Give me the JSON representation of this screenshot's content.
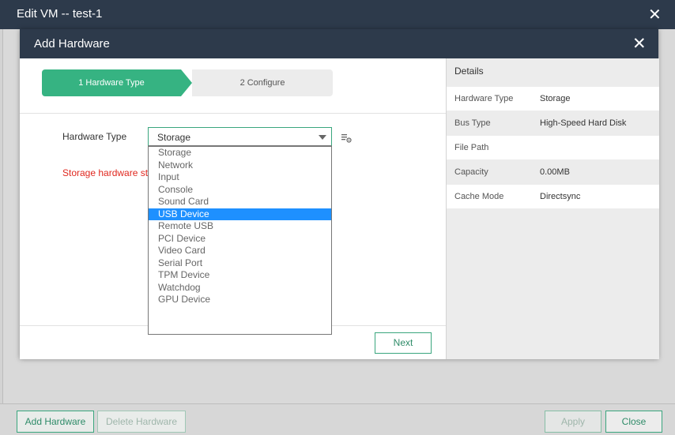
{
  "outer_window": {
    "title": "Edit VM -- test-1",
    "close_glyph": "✕",
    "buttons": {
      "add_hardware": "Add Hardware",
      "delete_hardware": "Delete Hardware",
      "apply": "Apply",
      "close": "Close"
    }
  },
  "modal": {
    "title": "Add Hardware",
    "close_glyph": "✕",
    "steps": [
      {
        "label": "1 Hardware Type",
        "active": true
      },
      {
        "label": "2 Configure",
        "active": false
      }
    ],
    "hardware_type_label": "Hardware Type",
    "hardware_type_value": "Storage",
    "warning_text": "Storage hardware sto",
    "dropdown_options": [
      "Storage",
      "Network",
      "Input",
      "Console",
      "Sound Card",
      "USB Device",
      "Remote USB",
      "PCI Device",
      "Video Card",
      "Serial Port",
      "TPM Device",
      "Watchdog",
      "GPU Device"
    ],
    "highlighted_option": "USB Device",
    "next_label": "Next"
  },
  "details": {
    "title": "Details",
    "rows": [
      {
        "key": "Hardware Type",
        "value": "Storage"
      },
      {
        "key": "Bus Type",
        "value": "High-Speed Hard Disk"
      },
      {
        "key": "File Path",
        "value": ""
      },
      {
        "key": "Capacity",
        "value": "0.00MB"
      },
      {
        "key": "Cache Mode",
        "value": "Directsync"
      }
    ]
  },
  "colors": {
    "titlebar": "#2d3a4b",
    "accent_green": "#36b382",
    "warning_red": "#e0281f",
    "selection_blue": "#1e90ff"
  }
}
